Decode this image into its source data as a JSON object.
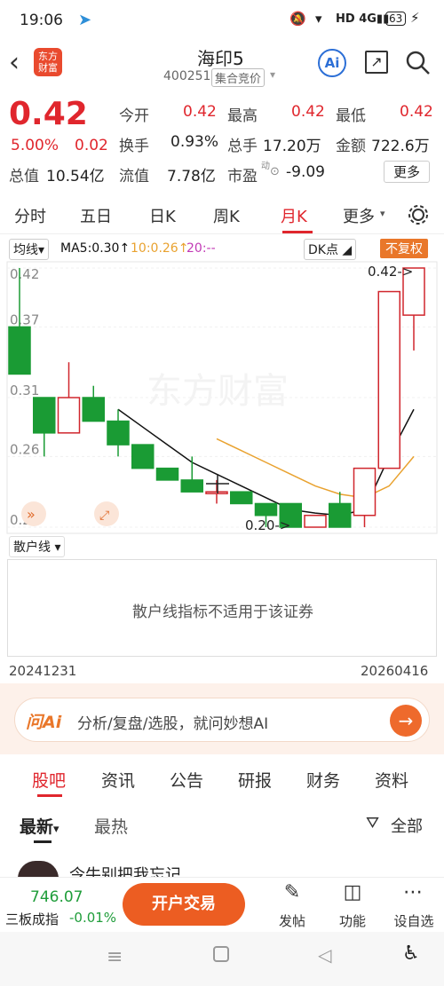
{
  "status": {
    "time": "19:06",
    "battery": "63"
  },
  "header": {
    "app_logo_line1": "东方",
    "app_logo_line2": "财富",
    "title": "海印5",
    "code": "400251",
    "auction_tag": "集合竞价"
  },
  "quote": {
    "price": "0.42",
    "change_pct": "5.00%",
    "change_val": "0.02",
    "open_label": "今开",
    "open": "0.42",
    "high_label": "最高",
    "high": "0.42",
    "low_label": "最低",
    "low": "0.42",
    "turnover_label": "换手",
    "turnover": "0.93%",
    "volume_label": "总手",
    "volume": "17.20万",
    "amount_label": "金额",
    "amount": "722.6万",
    "mktcap_label": "总值",
    "mktcap": "10.54亿",
    "float_label": "流值",
    "float": "7.78亿",
    "pe_label": "市盈",
    "pe_super": "动",
    "pe": "-9.09",
    "more_btn": "更多"
  },
  "tabs": [
    "分时",
    "五日",
    "日K",
    "周K",
    "月K",
    "更多"
  ],
  "chartbar": {
    "avg_dropdown": "均线",
    "ma5": "MA5:0.30↑",
    "ma10": "10:0.26↑",
    "ma20": "20:--",
    "dk_btn": "DK点",
    "fq_btn": "不复权"
  },
  "chart_data": {
    "type": "candlestick",
    "y_ticks": [
      "0.42",
      "0.37",
      "0.31",
      "0.26",
      "0.20"
    ],
    "max_marker": "0.42->",
    "min_marker": "0.20->",
    "ylim": [
      0.2,
      0.42
    ],
    "candles": [
      {
        "o": 0.37,
        "c": 0.33,
        "h": 0.42,
        "l": 0.33
      },
      {
        "o": 0.31,
        "c": 0.28,
        "h": 0.31,
        "l": 0.26
      },
      {
        "o": 0.28,
        "c": 0.31,
        "h": 0.34,
        "l": 0.28
      },
      {
        "o": 0.31,
        "c": 0.29,
        "h": 0.32,
        "l": 0.29
      },
      {
        "o": 0.29,
        "c": 0.27,
        "h": 0.3,
        "l": 0.26
      },
      {
        "o": 0.27,
        "c": 0.25,
        "h": 0.27,
        "l": 0.25
      },
      {
        "o": 0.25,
        "c": 0.24,
        "h": 0.25,
        "l": 0.24
      },
      {
        "o": 0.24,
        "c": 0.23,
        "h": 0.26,
        "l": 0.23
      },
      {
        "o": 0.23,
        "c": 0.23,
        "h": 0.24,
        "l": 0.22
      },
      {
        "o": 0.23,
        "c": 0.22,
        "h": 0.23,
        "l": 0.22
      },
      {
        "o": 0.22,
        "c": 0.21,
        "h": 0.22,
        "l": 0.2
      },
      {
        "o": 0.22,
        "c": 0.2,
        "h": 0.22,
        "l": 0.2
      },
      {
        "o": 0.2,
        "c": 0.21,
        "h": 0.21,
        "l": 0.2
      },
      {
        "o": 0.22,
        "c": 0.2,
        "h": 0.23,
        "l": 0.2
      },
      {
        "o": 0.21,
        "c": 0.25,
        "h": 0.25,
        "l": 0.2
      },
      {
        "o": 0.25,
        "c": 0.4,
        "h": 0.4,
        "l": 0.25
      },
      {
        "o": 0.38,
        "c": 0.42,
        "h": 0.42,
        "l": 0.35
      }
    ],
    "ma5": [
      null,
      null,
      null,
      null,
      0.3,
      0.285,
      0.27,
      0.255,
      0.245,
      0.235,
      0.225,
      0.215,
      0.212,
      0.21,
      0.215,
      0.26,
      0.3
    ],
    "ma10": [
      null,
      null,
      null,
      null,
      null,
      null,
      null,
      null,
      0.275,
      0.265,
      0.255,
      0.245,
      0.235,
      0.228,
      0.225,
      0.235,
      0.26
    ],
    "colors": {
      "up": "#d0262d",
      "down": "#1a9b34",
      "ma5": "#111111",
      "ma10": "#e9a22f"
    }
  },
  "subchart": {
    "label": "散户线",
    "message": "散户线指标不适用于该证券"
  },
  "dates": {
    "start": "20241231",
    "end": "20260416"
  },
  "ai": {
    "logo": "问Ai",
    "prompt": "分析/复盘/选股，就问妙想AI"
  },
  "subtabs": [
    "股吧",
    "资讯",
    "公告",
    "研报",
    "财务",
    "资料"
  ],
  "filters": {
    "latest": "最新",
    "hot": "最热",
    "all": "全部"
  },
  "post": {
    "partial_text": "令牛别把我忘记"
  },
  "bottom": {
    "index_value": "746.07",
    "index_name": "三板成指",
    "index_change": "-0.01%",
    "trade_btn": "开户交易",
    "post_btn": "发帖",
    "func_btn": "功能",
    "watch_btn": "设自选"
  }
}
